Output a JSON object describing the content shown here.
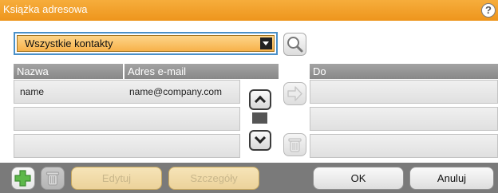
{
  "window": {
    "title": "Książka adresowa",
    "help_icon": "question-mark-icon"
  },
  "filter": {
    "selected": "Wszystkie kontakty"
  },
  "contacts_table": {
    "columns": [
      "Nazwa",
      "Adres e-mail"
    ],
    "rows": [
      {
        "name": "name",
        "email": "name@company.com"
      }
    ]
  },
  "recipients": {
    "header": "Do"
  },
  "buttons": {
    "edit": "Edytuj",
    "details": "Szczegóły",
    "ok": "OK",
    "cancel": "Anuluj"
  },
  "colors": {
    "title_bar": "#ee951c",
    "dropdown": "#f7b24a",
    "focus_border": "#4a90c8",
    "header": "#909090",
    "bottom_bar": "#7a7a7a",
    "add_icon": "#5db84a"
  }
}
